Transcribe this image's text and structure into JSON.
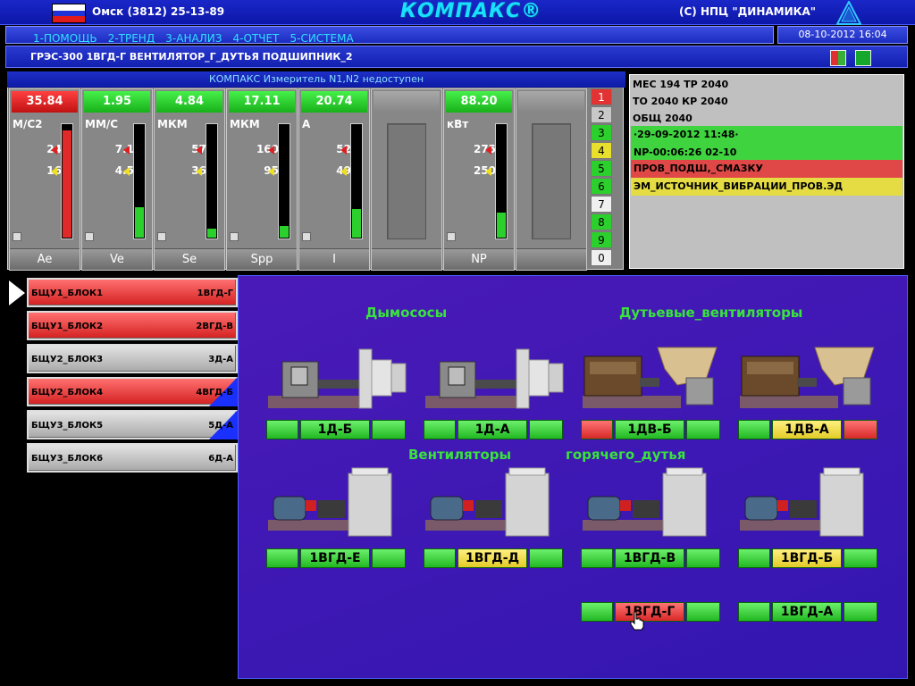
{
  "header": {
    "phone": "Омск (3812) 25-13-89",
    "logo": "КОМПАКС®",
    "company": "(С) НПЦ \"ДИНАМИКА\""
  },
  "menu": {
    "items": [
      "1-ПОМОЩЬ",
      "2-ТРЕНД",
      "3-АНАЛИЗ",
      "4-ОТЧЕТ",
      "5-СИСТЕМА"
    ],
    "datetime": "08-10-2012 16:04"
  },
  "title": "ГРЭС-300 1ВГД-Г ВЕНТИЛЯТОР_Г_ДУТЬЯ ПОДШИПНИК_2",
  "gauge_header": "КОМПАКС Измеритель N1,N2 недоступен",
  "gauges": [
    {
      "value": "35.84",
      "status": "red",
      "unit": "М/С2",
      "upper": "24",
      "lower": "16",
      "name": "Ae",
      "fill": 0.95
    },
    {
      "value": "1.95",
      "status": "green",
      "unit": "ММ/С",
      "upper": "7.1",
      "lower": "4.5",
      "name": "Ve",
      "fill": 0.27
    },
    {
      "value": "4.84",
      "status": "green",
      "unit": "МКМ",
      "upper": "57",
      "lower": "36",
      "name": "Se",
      "fill": 0.08
    },
    {
      "value": "17.11",
      "status": "green",
      "unit": "МКМ",
      "upper": "160",
      "lower": "95",
      "name": "Spp",
      "fill": 0.1
    },
    {
      "value": "20.74",
      "status": "green",
      "unit": "А",
      "upper": "52",
      "lower": "49",
      "name": "I",
      "fill": 0.25
    },
    {
      "value": "",
      "status": "gray",
      "unit": "",
      "upper": "",
      "lower": "",
      "name": "",
      "fill": 0
    },
    {
      "value": "88.20",
      "status": "green",
      "unit": "кВт",
      "upper": "275",
      "lower": "250",
      "name": "NP",
      "fill": 0.22
    },
    {
      "value": "",
      "status": "gray",
      "unit": "",
      "upper": "",
      "lower": "",
      "name": "",
      "fill": 0
    }
  ],
  "number_buttons": [
    {
      "label": "1",
      "color": "red"
    },
    {
      "label": "2",
      "color": "gray"
    },
    {
      "label": "3",
      "color": "green"
    },
    {
      "label": "4",
      "color": "yellow"
    },
    {
      "label": "5",
      "color": "green"
    },
    {
      "label": "6",
      "color": "green"
    },
    {
      "label": "7",
      "color": "white"
    },
    {
      "label": "8",
      "color": "green"
    },
    {
      "label": "9",
      "color": "green"
    },
    {
      "label": "0",
      "color": "white"
    }
  ],
  "messages": {
    "line1": "МЕС 194   ТР 2040",
    "line2": "ТО 2040   КР 2040",
    "line3": "ОБЩ 2040",
    "bar1": "·29-09-2012 11:48·",
    "bar2": "NP-00:06:26 02-10",
    "bar3": "ПРОВ_ПОДШ,_СМАЗКУ",
    "bar4": "ЭМ_ИСТОЧНИК_ВИБРАЦИИ_ПРОВ.ЭД"
  },
  "sidebar": [
    {
      "left": "БЩУ1_БЛОК1",
      "right": "1ВГД-Г",
      "color": "red",
      "corner": false
    },
    {
      "left": "БЩУ1_БЛОК2",
      "right": "2ВГД-В",
      "color": "red",
      "corner": false
    },
    {
      "left": "БЩУ2_БЛОК3",
      "right": "3Д-А",
      "color": "gray",
      "corner": false
    },
    {
      "left": "БЩУ2_БЛОК4",
      "right": "4ВГД-Б",
      "color": "red",
      "corner": true
    },
    {
      "left": "БЩУ3_БЛОК5",
      "right": "5Д-А",
      "color": "gray",
      "corner": true
    },
    {
      "left": "БЩУ3_БЛОК6",
      "right": "6Д-А",
      "color": "gray",
      "corner": false
    }
  ],
  "main": {
    "heading_smoke": "Дымососы",
    "heading_fans": "Дутьевые_вентиляторы",
    "heading_hot1": "Вентиляторы",
    "heading_hot2": "горячего_дутья"
  },
  "units": [
    {
      "name": "1Д-Б",
      "left": "g",
      "mid": "g",
      "right": "g",
      "type": "smoke"
    },
    {
      "name": "1Д-А",
      "left": "g",
      "mid": "g",
      "right": "g",
      "type": "smoke"
    },
    {
      "name": "1ДВ-Б",
      "left": "rd",
      "mid": "g",
      "right": "g",
      "type": "blower"
    },
    {
      "name": "1ДВ-А",
      "left": "g",
      "mid": "ye",
      "right": "rd",
      "type": "blower"
    },
    {
      "name": "1ВГД-Е",
      "left": "g",
      "mid": "g",
      "right": "g",
      "type": "hot"
    },
    {
      "name": "1ВГД-Д",
      "left": "g",
      "mid": "ye",
      "right": "g",
      "type": "hot"
    },
    {
      "name": "1ВГД-В",
      "left": "g",
      "mid": "g",
      "right": "g",
      "type": "hot"
    },
    {
      "name": "1ВГД-Б",
      "left": "g",
      "mid": "ye",
      "right": "g",
      "type": "hot"
    },
    {
      "name": "1ВГД-Г",
      "left": "g",
      "mid": "rd",
      "right": "g",
      "type": "none"
    },
    {
      "name": "1ВГД-А",
      "left": "g",
      "mid": "g",
      "right": "g",
      "type": "none"
    }
  ]
}
